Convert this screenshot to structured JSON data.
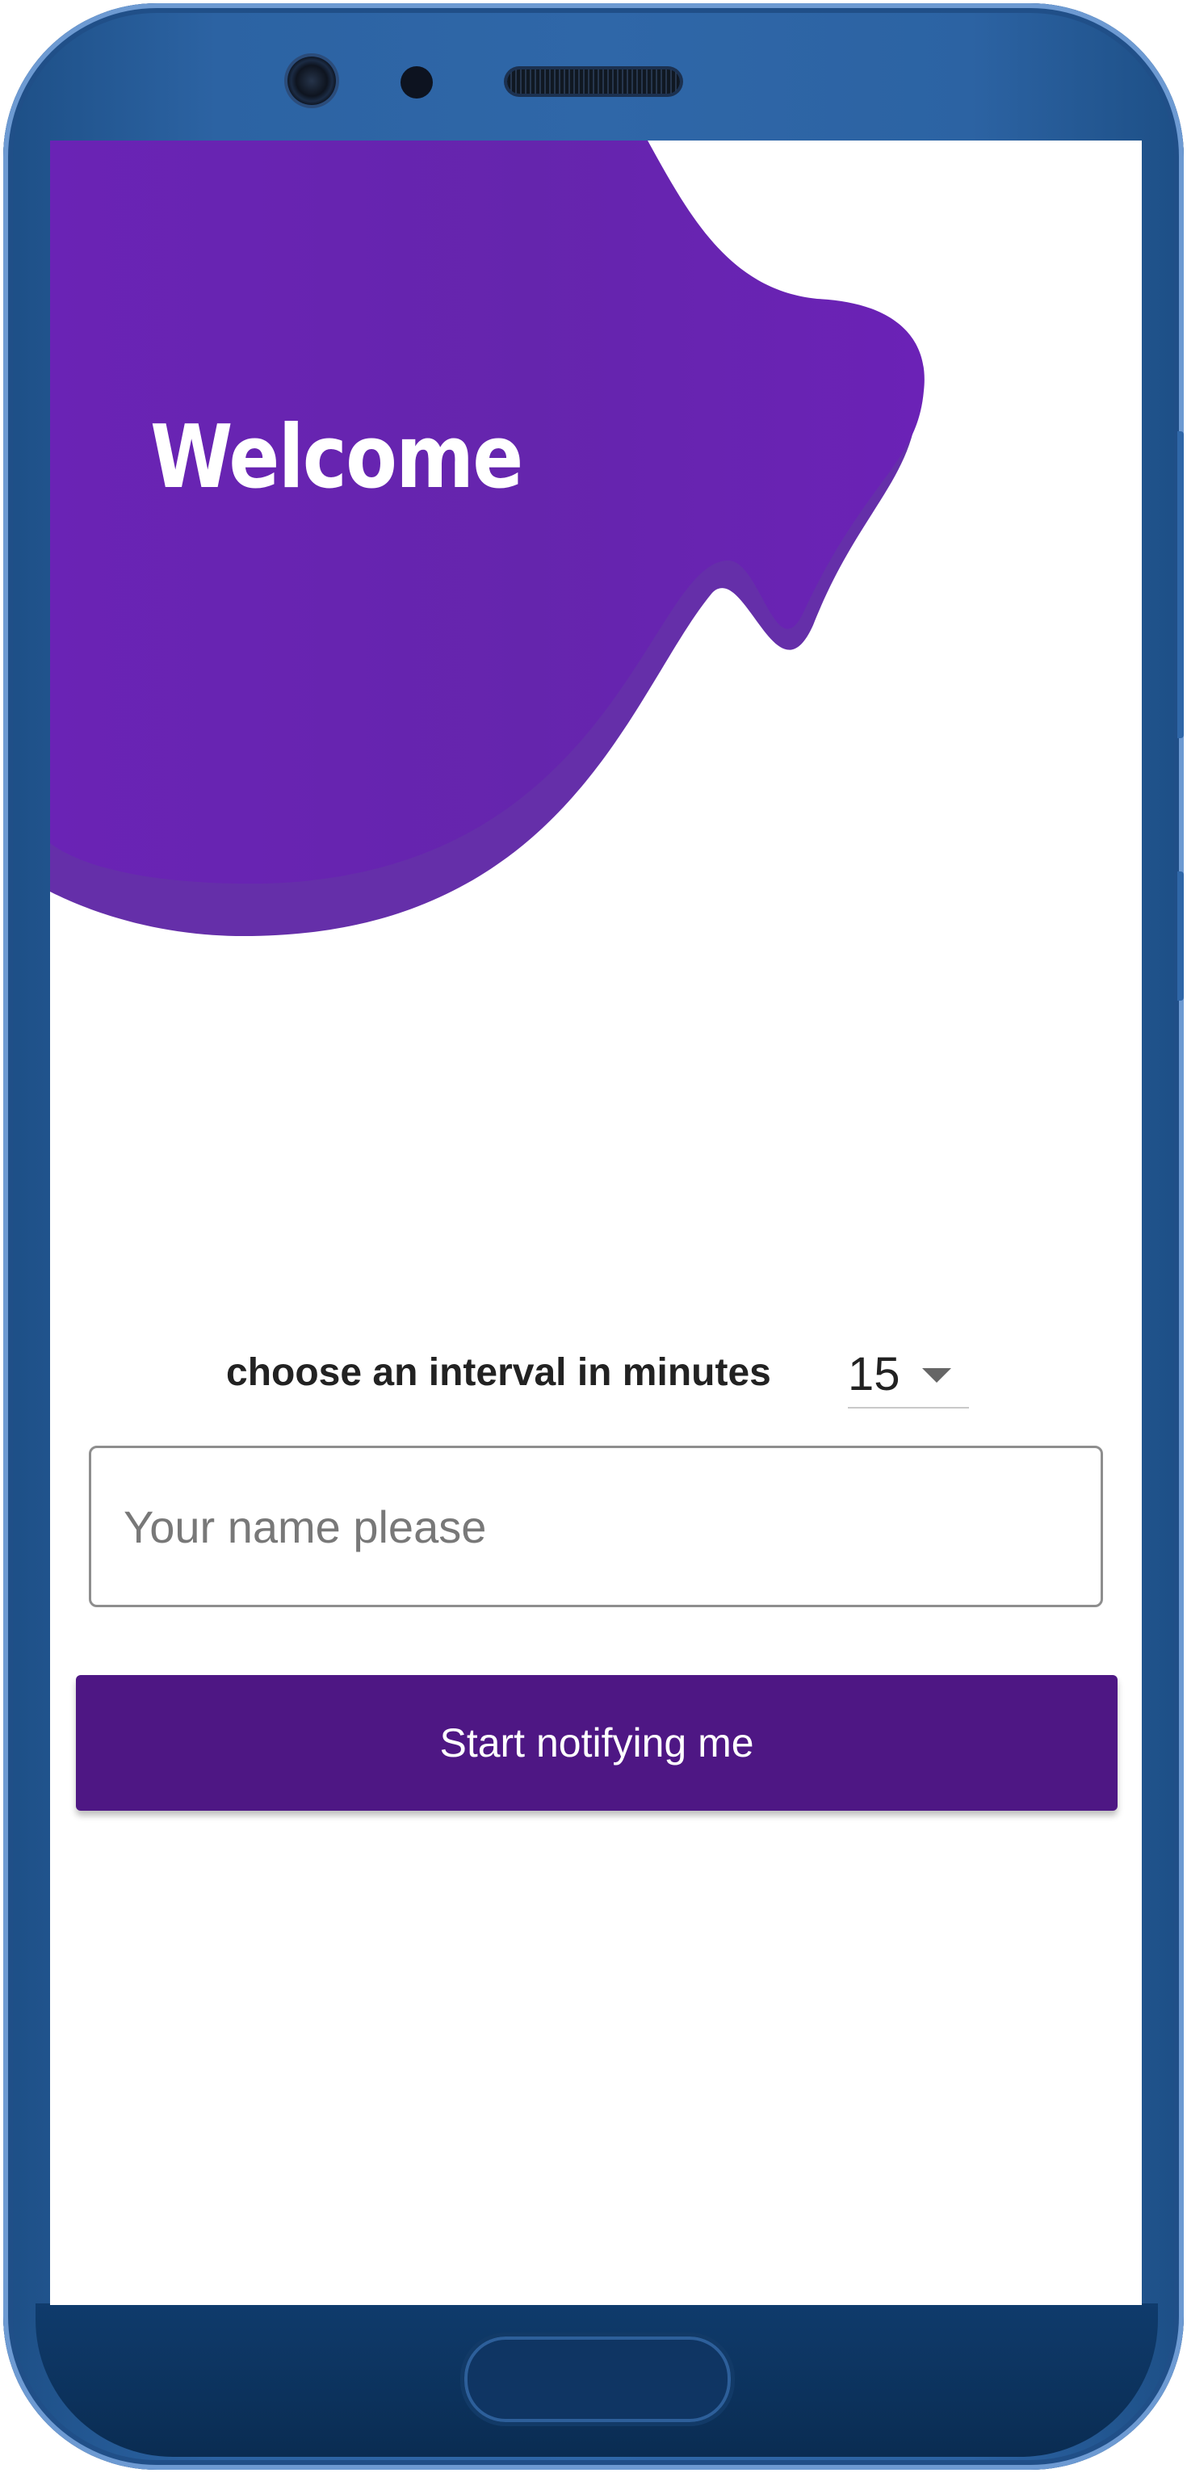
{
  "header": {
    "title": "Welcome"
  },
  "form": {
    "interval_label": "choose an interval in minutes",
    "interval_value": "15",
    "name_placeholder": "Your name please",
    "name_value": "",
    "submit_label": "Start notifying me"
  },
  "icons": {
    "interval_dropdown": "chevron-down-icon"
  },
  "colors": {
    "brand_purple": "#6a23b5",
    "brand_shadow": "#5418a0",
    "button_purple": "#4e1784",
    "frame_blue": "#2f67a8"
  }
}
